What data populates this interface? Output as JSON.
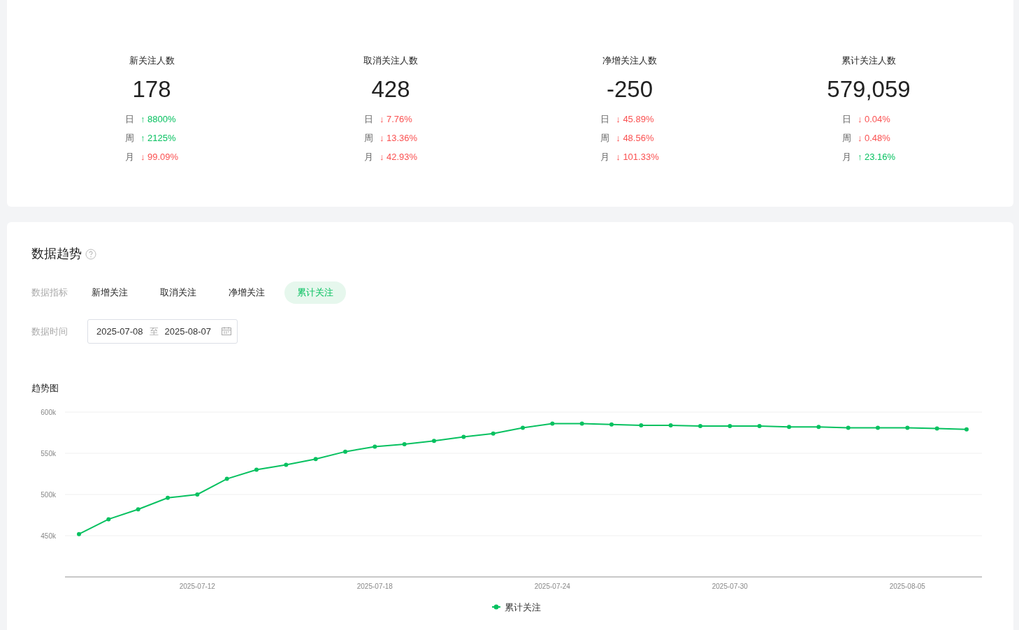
{
  "stats": [
    {
      "title": "新关注人数",
      "value": "178",
      "changes": [
        {
          "period": "日",
          "arrow": "↑",
          "value": "8800%",
          "color": "#07c160"
        },
        {
          "period": "周",
          "arrow": "↑",
          "value": "2125%",
          "color": "#07c160"
        },
        {
          "period": "月",
          "arrow": "↓",
          "value": "99.09%",
          "color": "#fa5151"
        }
      ]
    },
    {
      "title": "取消关注人数",
      "value": "428",
      "changes": [
        {
          "period": "日",
          "arrow": "↓",
          "value": "7.76%",
          "color": "#fa5151"
        },
        {
          "period": "周",
          "arrow": "↓",
          "value": "13.36%",
          "color": "#fa5151"
        },
        {
          "period": "月",
          "arrow": "↓",
          "value": "42.93%",
          "color": "#fa5151"
        }
      ]
    },
    {
      "title": "净增关注人数",
      "value": "-250",
      "changes": [
        {
          "period": "日",
          "arrow": "↓",
          "value": "45.89%",
          "color": "#fa5151"
        },
        {
          "period": "周",
          "arrow": "↓",
          "value": "48.56%",
          "color": "#fa5151"
        },
        {
          "period": "月",
          "arrow": "↓",
          "value": "101.33%",
          "color": "#fa5151"
        }
      ]
    },
    {
      "title": "累计关注人数",
      "value": "579,059",
      "changes": [
        {
          "period": "日",
          "arrow": "↓",
          "value": "0.04%",
          "color": "#fa5151"
        },
        {
          "period": "周",
          "arrow": "↓",
          "value": "0.48%",
          "color": "#fa5151"
        },
        {
          "period": "月",
          "arrow": "↑",
          "value": "23.16%",
          "color": "#07c160"
        }
      ]
    }
  ],
  "trend": {
    "title": "数据趋势",
    "metric_label": "数据指标",
    "metrics": [
      {
        "label": "新增关注",
        "selected": false
      },
      {
        "label": "取消关注",
        "selected": false
      },
      {
        "label": "净增关注",
        "selected": false
      },
      {
        "label": "累计关注",
        "selected": true
      }
    ],
    "time_label": "数据时间",
    "date_range": {
      "start": "2025-07-08",
      "separator": "至",
      "end": "2025-08-07"
    },
    "chart_title": "趋势图",
    "chart_data": {
      "type": "line",
      "grid": true,
      "categories": [
        null,
        null,
        null,
        null,
        "2025-07-12",
        null,
        null,
        null,
        null,
        null,
        "2025-07-18",
        null,
        null,
        null,
        null,
        null,
        "2025-07-24",
        null,
        null,
        null,
        null,
        null,
        "2025-07-30",
        null,
        null,
        null,
        null,
        null,
        "2025-08-05",
        null,
        null
      ],
      "series": [
        {
          "name": "累计关注",
          "color": "#07c160",
          "marker": true,
          "values": [
            452000,
            470000,
            482000,
            496000,
            500000,
            519000,
            530000,
            536000,
            543000,
            552000,
            558000,
            561000,
            565000,
            570000,
            574000,
            581000,
            586000,
            586000,
            585000,
            584000,
            584000,
            583000,
            583000,
            583000,
            582000,
            582000,
            581000,
            581000,
            581000,
            580000,
            579000
          ]
        }
      ],
      "ylim": [
        400000,
        600000
      ],
      "yticks": [
        {
          "value": 450000,
          "label": "450k"
        },
        {
          "value": 500000,
          "label": "500k"
        },
        {
          "value": 550000,
          "label": "550k"
        },
        {
          "value": 600000,
          "label": "600k"
        }
      ]
    }
  }
}
